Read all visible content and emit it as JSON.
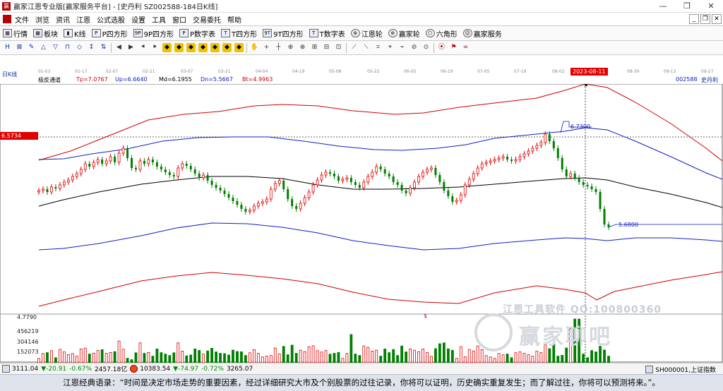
{
  "window": {
    "title": "赢家江恩专业版[赢家服务平台] - [史丹利  SZ002588-184日K线]"
  },
  "menu": [
    "文件",
    "浏览",
    "资讯",
    "江恩",
    "公式选股",
    "设置",
    "工具",
    "窗口",
    "交易委托",
    "帮助"
  ],
  "toolbar1": [
    "行情",
    "板块",
    "K线",
    "P四方形",
    "9P四方形",
    "P数字表",
    "T四方形",
    "9T四方形",
    "T数字表",
    "江恩轮",
    "赢家轮",
    "六角形",
    "赢家服务"
  ],
  "toolbar2_icons": [
    "H",
    "⊠",
    "✎",
    "△",
    "▽",
    "⊓",
    "◇",
    "↕",
    "⇅",
    "◀",
    "▶",
    "⯇",
    "⯈",
    "◆",
    "◆",
    "◆",
    "◆",
    "◆",
    "◆",
    "◆",
    "✋",
    "+",
    "┼",
    "⊕",
    "⊗",
    "⊞",
    "⊟",
    "⊡",
    "⟋",
    "⟍",
    "⌗",
    "⌖",
    "⌁",
    "⊘",
    "⊙",
    "⦿",
    "⚑",
    "∞"
  ],
  "period_label": "日K线",
  "dates": [
    "01-03",
    "01-17",
    "02-07",
    "02-21",
    "03-07",
    "03-21",
    "04-04",
    "04-19",
    "05-08",
    "05-22",
    "06-05",
    "06-19",
    "07-05",
    "07-19",
    "08-02",
    "08-30",
    "09-13",
    "09-27"
  ],
  "current_date": "2023-08-11",
  "indicator": {
    "name": "极反通道",
    "tp": "Tp=7.0767",
    "up": "Up=6.6640",
    "md": "Md=6.1955",
    "dn": "Dn=5.5667",
    "bt": "Bt=4.9963"
  },
  "stock": {
    "code": "002588",
    "name": "史丹利"
  },
  "price_tag": "6.5734",
  "high_label": "6.7300",
  "low_label": "5.6800",
  "vol_axis": [
    "4.7790",
    "456219",
    "304146",
    "152073"
  ],
  "marker": "$",
  "watermark": {
    "line1": "江恩工具软件  QQ:100800360",
    "line2": "赢家聊吧"
  },
  "status": {
    "sh": {
      "index": "3111.04",
      "change": "▼-20.91",
      "pct": "-0.67%",
      "amount": "2457.18亿"
    },
    "sz": {
      "index": "10383.54",
      "change": "▼-74.97",
      "pct": "-0.72%",
      "amount": "3265.07"
    },
    "right_label": "SH000001,上证指数"
  },
  "quote": "江恩经典语录：“时间是决定市场走势的重要因素，经过详细研究大市及个别股票的过往记录，你将可以证明，历史确实重复发生；而了解过往，你将可以预测将来。”。",
  "colors": {
    "up": "#e00000",
    "down": "#008000",
    "channel_outer": "#d00000",
    "channel_inner": "#1020c0",
    "mid": "#000000"
  }
}
